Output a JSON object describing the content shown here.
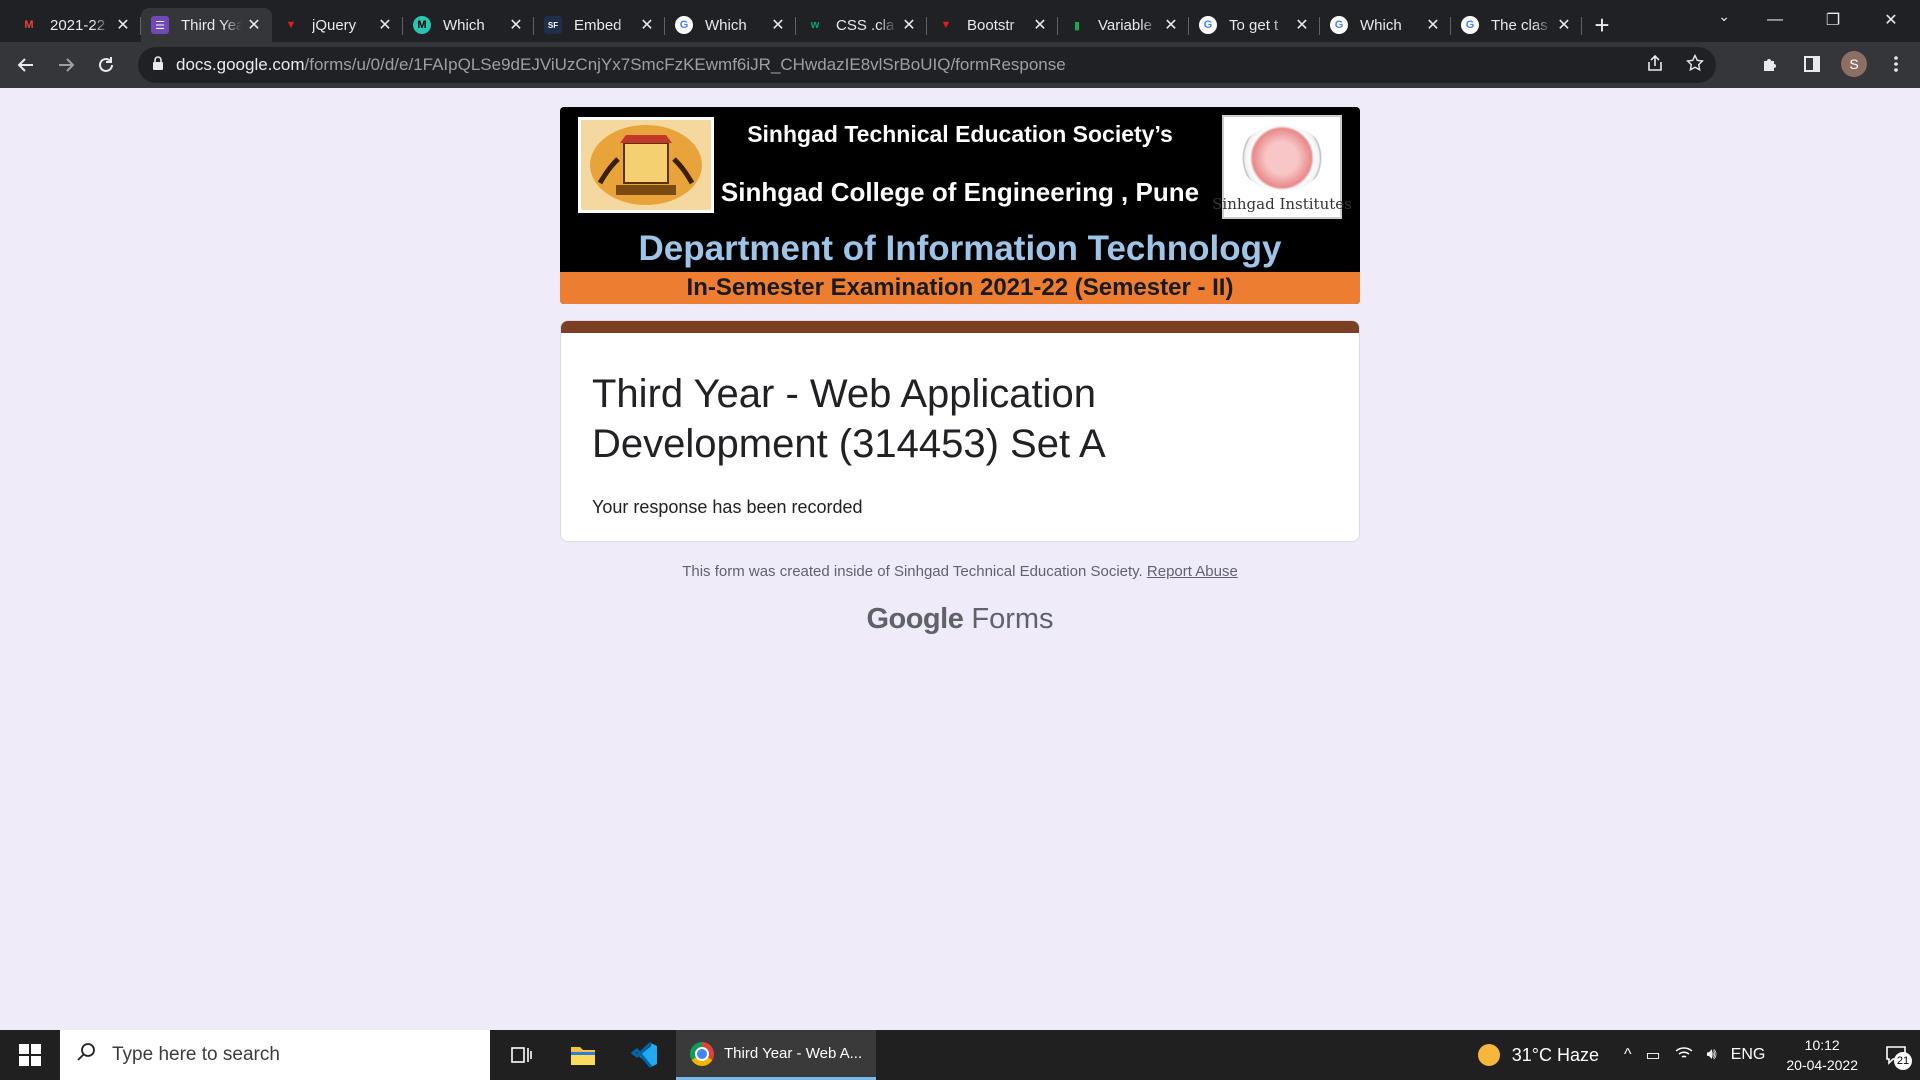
{
  "browser": {
    "tabs": [
      {
        "title": "2021-22",
        "icon": "gmail-icon",
        "color": "#ea4335",
        "glyph": "M"
      },
      {
        "title": "Third Year",
        "icon": "google-forms-icon",
        "color": "#7248b9",
        "glyph": "☰"
      },
      {
        "title": "jQuery",
        "icon": "red-shield-icon",
        "color": "#e21b1b",
        "glyph": "▼"
      },
      {
        "title": "Which",
        "icon": "m-logo-icon",
        "color": "#2bc4b3",
        "glyph": "M"
      },
      {
        "title": "Embed",
        "icon": "sf-logo-icon",
        "color": "#1f2e4a",
        "glyph": "SF"
      },
      {
        "title": "Which",
        "icon": "google-icon",
        "color": "#ffffff",
        "glyph": "G"
      },
      {
        "title": "CSS .cla",
        "icon": "w3schools-icon",
        "color": "#04aa6d",
        "glyph": "w"
      },
      {
        "title": "Bootstr",
        "icon": "red-shield-icon",
        "color": "#e21b1b",
        "glyph": "▼"
      },
      {
        "title": "Variable",
        "icon": "green-bar-icon",
        "color": "#1ba94c",
        "glyph": "▮"
      },
      {
        "title": "To get t",
        "icon": "google-icon",
        "color": "#ffffff",
        "glyph": "G"
      },
      {
        "title": "Which",
        "icon": "google-icon",
        "color": "#ffffff",
        "glyph": "G"
      },
      {
        "title": "The clas",
        "icon": "google-icon",
        "color": "#ffffff",
        "glyph": "G"
      }
    ],
    "url_host": "docs.google.com",
    "url_path": "/forms/u/0/d/e/1FAIpQLSe9dEJViUzCnjYx7SmcFzKEwmf6iJR_CHwdazIE8vlSrBoUIQ/formResponse",
    "avatar_letter": "S"
  },
  "banner": {
    "society": "Sinhgad Technical Education Society’s",
    "college": "Sinhgad College of Engineering , Pune",
    "department": "Department of Information Technology",
    "exam": "In-Semester Examination 2021-22 (Semester - II)",
    "right_logo_text": "Sinhgad Institutes"
  },
  "form": {
    "title": "Third Year - Web Application Development (314453) Set A",
    "confirmation": "Your response has been recorded",
    "accent_color": "#7b3f23"
  },
  "footer": {
    "note": "This form was created inside of Sinhgad Technical Education Society.",
    "report_link": "Report Abuse",
    "brand_google": "Google",
    "brand_forms": "Forms"
  },
  "taskbar": {
    "search_placeholder": "Type here to search",
    "active_window": "Third Year - Web A...",
    "weather": "31°C  Haze",
    "language": "ENG",
    "time": "10:12",
    "date": "20-04-2022",
    "notifications": "21"
  }
}
